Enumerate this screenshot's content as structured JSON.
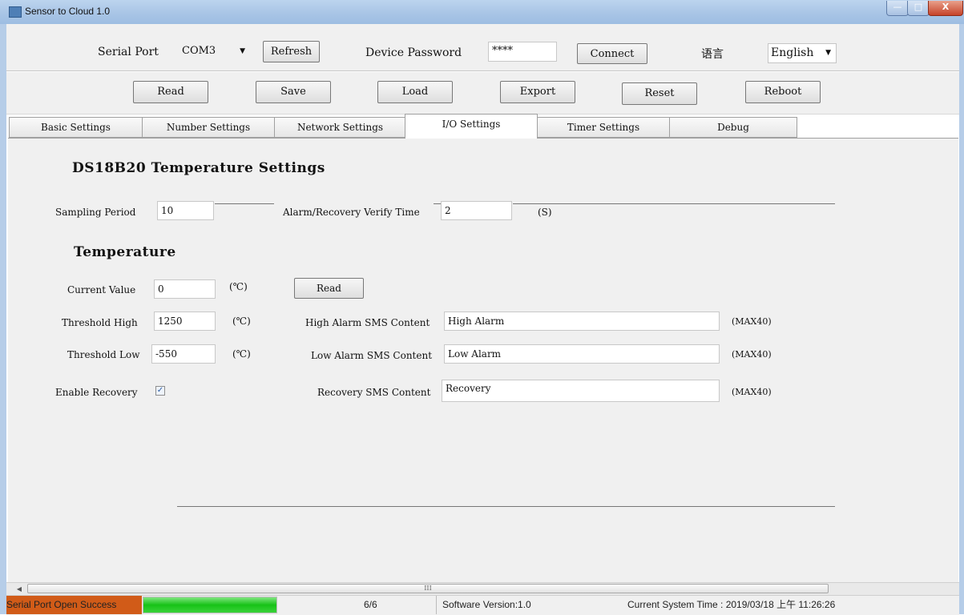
{
  "window": {
    "title": "Sensor to Cloud 1.0"
  },
  "toolbar": {
    "serial_port_label": "Serial Port",
    "serial_port_value": "COM3",
    "refresh_label": "Refresh",
    "device_password_label": "Device Password",
    "device_password_value": "****",
    "connect_label": "Connect",
    "language_label": "语言",
    "language_value": "English"
  },
  "actions": {
    "read": "Read",
    "save": "Save",
    "load": "Load",
    "export": "Export",
    "reset": "Reset",
    "reboot": "Reboot"
  },
  "tabs": [
    {
      "label": "Basic Settings"
    },
    {
      "label": "Number Settings"
    },
    {
      "label": "Network Settings"
    },
    {
      "label": "I/O Settings"
    },
    {
      "label": "Timer Settings"
    },
    {
      "label": "Debug"
    }
  ],
  "active_tab": "I/O Settings",
  "io": {
    "section_title": "DS18B20 Temperature Settings",
    "sampling_period_label": "Sampling Period",
    "sampling_period_value": "10",
    "verify_time_label": "Alarm/Recovery Verify Time",
    "verify_time_value": "2",
    "verify_time_unit": "(S)",
    "temperature_title": "Temperature",
    "current_value_label": "Current Value",
    "current_value": "0",
    "celsius_unit": "(℃)",
    "read_button": "Read",
    "threshold_high_label": "Threshold High",
    "threshold_high_value": "1250",
    "threshold_low_label": "Threshold Low",
    "threshold_low_value": "-550",
    "enable_recovery_label": "Enable Recovery",
    "enable_recovery_checked": true,
    "high_alarm_label": "High Alarm SMS Content",
    "high_alarm_value": "High Alarm",
    "low_alarm_label": "Low Alarm SMS Content",
    "low_alarm_value": "Low Alarm",
    "recovery_label": "Recovery SMS Content",
    "recovery_value": "Recovery",
    "max_note": "(MAX40)"
  },
  "scrollbar": {
    "grip": "III"
  },
  "status": {
    "serial_status": "Serial Port Open Success",
    "progress_fraction": 1.0,
    "progress_text": "6/6",
    "software_version": "Software Version:1.0",
    "system_time": "Current System Time : 2019/03/18 上午 11:26:26"
  },
  "colors": {
    "status_error_bg": "#d15b18",
    "progress_green": "#17c217",
    "titlebar": "#a9c5e6"
  }
}
